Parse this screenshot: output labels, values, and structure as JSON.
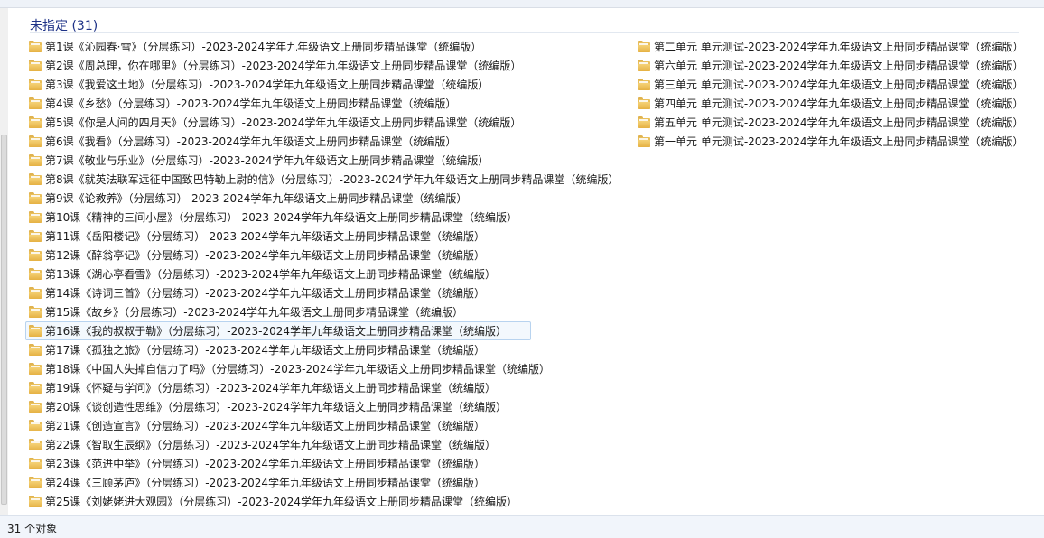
{
  "group": {
    "title": "未指定 (31)"
  },
  "left_items": [
    {
      "label": "第1课《沁园春·雪》（分层练习）-2023-2024学年九年级语文上册同步精品课堂（统编版）"
    },
    {
      "label": "第2课《周总理，你在哪里》（分层练习）-2023-2024学年九年级语文上册同步精品课堂（统编版）"
    },
    {
      "label": "第3课《我爱这土地》（分层练习）-2023-2024学年九年级语文上册同步精品课堂（统编版）"
    },
    {
      "label": "第4课《乡愁》（分层练习）-2023-2024学年九年级语文上册同步精品课堂（统编版）"
    },
    {
      "label": "第5课《你是人间的四月天》（分层练习）-2023-2024学年九年级语文上册同步精品课堂（统编版）"
    },
    {
      "label": "第6课《我看》（分层练习）-2023-2024学年九年级语文上册同步精品课堂（统编版）"
    },
    {
      "label": "第7课《敬业与乐业》（分层练习）-2023-2024学年九年级语文上册同步精品课堂（统编版）"
    },
    {
      "label": "第8课《就英法联军远征中国致巴特勒上尉的信》（分层练习）-2023-2024学年九年级语文上册同步精品课堂（统编版）"
    },
    {
      "label": "第9课《论教养》（分层练习）-2023-2024学年九年级语文上册同步精品课堂（统编版）"
    },
    {
      "label": "第10课《精神的三间小屋》（分层练习）-2023-2024学年九年级语文上册同步精品课堂（统编版）"
    },
    {
      "label": "第11课《岳阳楼记》（分层练习）-2023-2024学年九年级语文上册同步精品课堂（统编版）"
    },
    {
      "label": "第12课《醉翁亭记》（分层练习）-2023-2024学年九年级语文上册同步精品课堂（统编版）"
    },
    {
      "label": "第13课《湖心亭看雪》（分层练习）-2023-2024学年九年级语文上册同步精品课堂（统编版）"
    },
    {
      "label": "第14课《诗词三首》（分层练习）-2023-2024学年九年级语文上册同步精品课堂（统编版）"
    },
    {
      "label": "第15课《故乡》（分层练习）-2023-2024学年九年级语文上册同步精品课堂（统编版）"
    },
    {
      "label": "第16课《我的叔叔于勒》（分层练习）-2023-2024学年九年级语文上册同步精品课堂（统编版）",
      "selected": true
    },
    {
      "label": "第17课《孤独之旅》（分层练习）-2023-2024学年九年级语文上册同步精品课堂（统编版）"
    },
    {
      "label": "第18课《中国人失掉自信力了吗》（分层练习）-2023-2024学年九年级语文上册同步精品课堂（统编版）"
    },
    {
      "label": "第19课《怀疑与学问》（分层练习）-2023-2024学年九年级语文上册同步精品课堂（统编版）"
    },
    {
      "label": "第20课《谈创造性思维》（分层练习）-2023-2024学年九年级语文上册同步精品课堂（统编版）"
    },
    {
      "label": "第21课《创造宣言》（分层练习）-2023-2024学年九年级语文上册同步精品课堂（统编版）"
    },
    {
      "label": "第22课《智取生辰纲》（分层练习）-2023-2024学年九年级语文上册同步精品课堂（统编版）"
    },
    {
      "label": "第23课《范进中举》（分层练习）-2023-2024学年九年级语文上册同步精品课堂（统编版）"
    },
    {
      "label": "第24课《三顾茅庐》（分层练习）-2023-2024学年九年级语文上册同步精品课堂（统编版）"
    },
    {
      "label": "第25课《刘姥姥进大观园》（分层练习）-2023-2024学年九年级语文上册同步精品课堂（统编版）"
    }
  ],
  "right_items": [
    {
      "label": "第二单元 单元测试-2023-2024学年九年级语文上册同步精品课堂（统编版）"
    },
    {
      "label": "第六单元 单元测试-2023-2024学年九年级语文上册同步精品课堂（统编版）"
    },
    {
      "label": "第三单元 单元测试-2023-2024学年九年级语文上册同步精品课堂（统编版）"
    },
    {
      "label": "第四单元 单元测试-2023-2024学年九年级语文上册同步精品课堂（统编版）"
    },
    {
      "label": "第五单元 单元测试-2023-2024学年九年级语文上册同步精品课堂（统编版）"
    },
    {
      "label": "第一单元 单元测试-2023-2024学年九年级语文上册同步精品课堂（统编版）"
    }
  ],
  "status": {
    "text": "31 个对象"
  },
  "icon": "folder-icon",
  "colors": {
    "group_title": "#1e3287",
    "folder": "#e9bf5a",
    "selection_border": "#b8d3ef"
  }
}
